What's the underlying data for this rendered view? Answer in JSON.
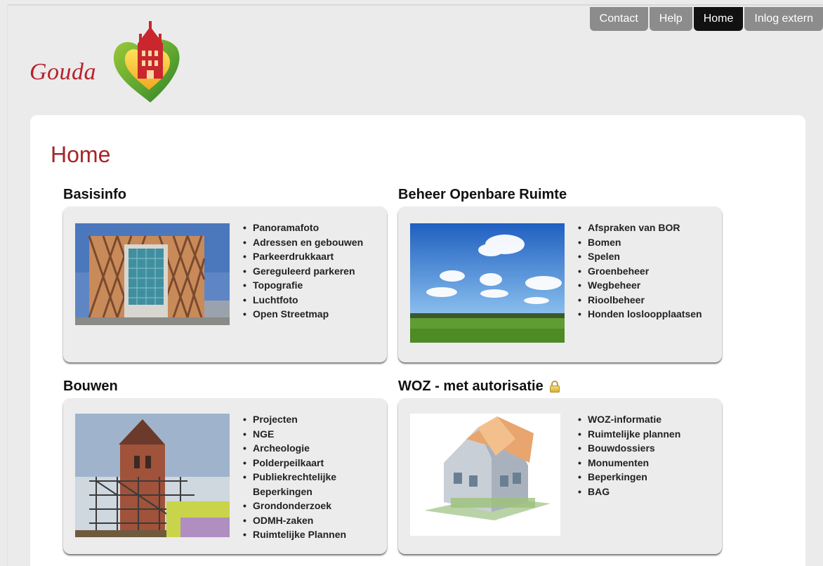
{
  "nav": {
    "tabs": [
      {
        "label": "Contact",
        "active": false
      },
      {
        "label": "Help",
        "active": false
      },
      {
        "label": "Home",
        "active": true
      },
      {
        "label": "Inlog extern",
        "active": false
      }
    ]
  },
  "logo": {
    "text": "Gouda"
  },
  "page": {
    "title": "Home"
  },
  "sections": [
    {
      "title": "Basisinfo",
      "image": "city-hall-photo",
      "links": [
        "Panoramafoto",
        "Adressen en gebouwen",
        "Parkeerdrukkaart",
        "Gereguleerd parkeren",
        "Topografie",
        "Luchtfoto",
        "Open Streetmap"
      ]
    },
    {
      "title": "Beheer Openbare Ruimte",
      "image": "meadow-sky-photo",
      "links": [
        "Afspraken van BOR",
        "Bomen",
        "Spelen",
        "Groenbeheer",
        "Wegbeheer",
        "Rioolbeheer",
        "Honden losloopplaatsen"
      ]
    },
    {
      "title": "Bouwen",
      "image": "church-scaffolding-photo",
      "links": [
        "Projecten",
        "NGE",
        "Archeologie",
        "Polderpeilkaart",
        "Publiekrechtelijke Beperkingen",
        "Grondonderzoek",
        "ODMH-zaken",
        "Ruimtelijke Plannen"
      ]
    },
    {
      "title": "WOZ - met autorisatie",
      "image": "money-house-photo",
      "icon": "lock-icon",
      "links": [
        "WOZ-informatie",
        "Ruimtelijke plannen",
        "Bouwdossiers",
        "Monumenten",
        "Beperkingen",
        "BAG"
      ]
    }
  ],
  "colors": {
    "title": "#a3262a",
    "nav_tab": "#8c8c8c",
    "nav_active": "#111111",
    "card_bg": "#ececec",
    "logo_red": "#b8222c"
  }
}
